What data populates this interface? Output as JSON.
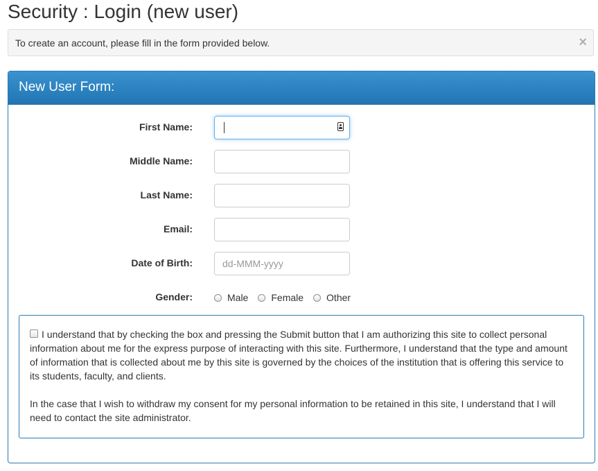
{
  "page": {
    "title": "Security : Login (new user)"
  },
  "alert": {
    "message": "To create an account, please fill in the form provided below.",
    "close_glyph": "×"
  },
  "form": {
    "heading": "New User Form:",
    "first_name": {
      "label": "First Name:",
      "value": "",
      "placeholder": ""
    },
    "middle_name": {
      "label": "Middle Name:",
      "value": "",
      "placeholder": ""
    },
    "last_name": {
      "label": "Last Name:",
      "value": "",
      "placeholder": ""
    },
    "email": {
      "label": "Email:",
      "value": "",
      "placeholder": ""
    },
    "dob": {
      "label": "Date of Birth:",
      "value": "",
      "placeholder": "dd-MMM-yyyy"
    },
    "gender": {
      "label": "Gender:",
      "options": [
        "Male",
        "Female",
        "Other"
      ]
    }
  },
  "consent": {
    "paragraph1": "I understand that by checking the box and pressing the Submit button that I am authorizing this site to collect personal information about me for the express purpose of interacting with this site. Furthermore, I understand that the type and amount of information that is collected about me by this site is governed by the choices of the institution that is offering this service to its students, faculty, and clients.",
    "paragraph2": "In the case that I wish to withdraw my consent for my personal information to be retained in this site, I understand that I will need to contact the site administrator."
  },
  "icons": {
    "first_name_field": "contact-card-icon"
  },
  "colors": {
    "panel_header": "#2a7bb1",
    "focus_border": "#66afe9"
  }
}
